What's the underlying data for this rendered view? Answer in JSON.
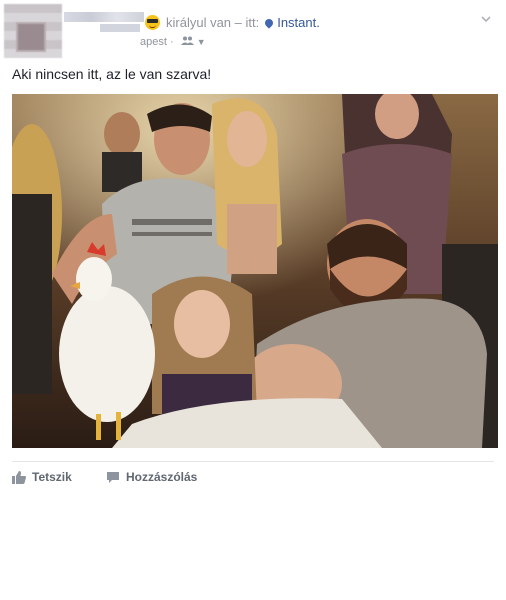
{
  "post": {
    "author_suffix": "királyul van – itt:",
    "location": "Instant.",
    "sub_time": "apest ·",
    "text": "Aki nincsen itt, az le van szarva!"
  },
  "icons": {
    "feeling": "sunglasses-emoji-icon",
    "location": "location-pin-icon",
    "audience": "friends-icon",
    "menu": "chevron-down-icon",
    "like": "thumbs-up-icon",
    "comment": "comment-icon"
  },
  "actions": {
    "like_label": "Tetszik",
    "comment_label": "Hozzászólás"
  },
  "colors": {
    "link": "#365899",
    "muted": "#90949c",
    "action": "#606770"
  }
}
